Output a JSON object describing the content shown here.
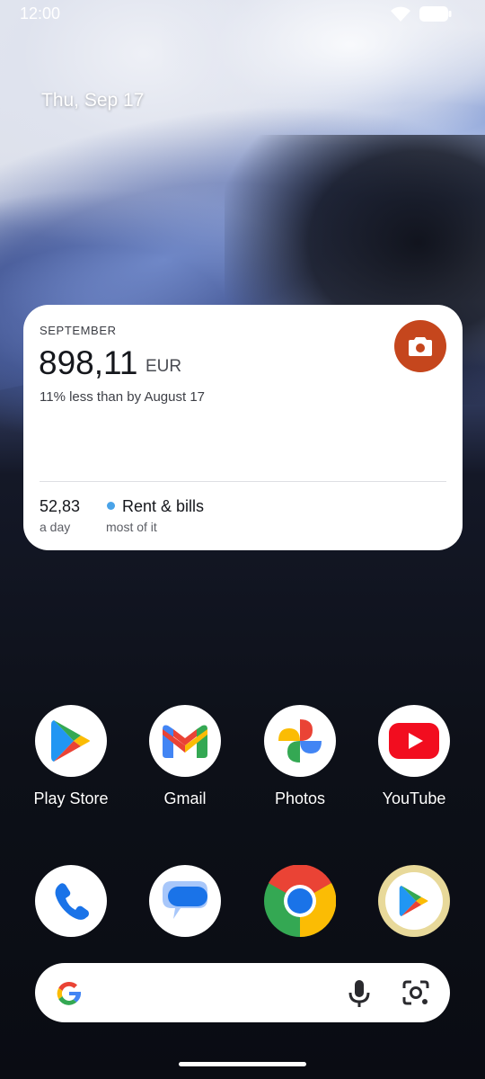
{
  "status": {
    "time": "12:00"
  },
  "date": "Thu, Sep 17",
  "widget": {
    "month": "SEPTEMBER",
    "amount": "898,11",
    "currency": "EUR",
    "comparison": "11% less than by August 17",
    "daily_value": "52,83",
    "daily_label": "a day",
    "category": "Rent & bills",
    "category_label": "most of it",
    "colors": {
      "camera_button": "#c5461d",
      "category_dot": "#4aa3e8"
    }
  },
  "apps": [
    {
      "label": "Play Store",
      "icon": "play-store-icon"
    },
    {
      "label": "Gmail",
      "icon": "gmail-icon"
    },
    {
      "label": "Photos",
      "icon": "photos-icon"
    },
    {
      "label": "YouTube",
      "icon": "youtube-icon"
    }
  ],
  "dock": [
    {
      "icon": "phone-icon"
    },
    {
      "icon": "messages-icon"
    },
    {
      "icon": "chrome-icon"
    },
    {
      "icon": "play-store-beta-icon"
    }
  ],
  "search": {
    "icons": [
      "google-icon",
      "microphone-icon",
      "lens-icon"
    ]
  }
}
